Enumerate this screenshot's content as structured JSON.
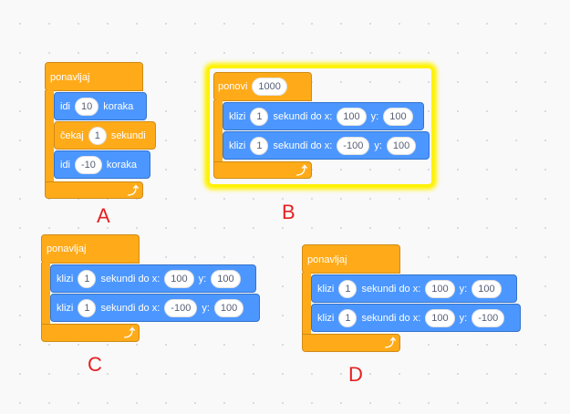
{
  "scripts": {
    "A": {
      "letter": "A",
      "loop_label": "ponavljaj",
      "blocks": [
        {
          "parts": [
            "idi",
            "10",
            "koraka"
          ]
        },
        {
          "parts": [
            "čekaj",
            "1",
            "sekundi"
          ]
        },
        {
          "parts": [
            "idi",
            "-10",
            "koraka"
          ]
        }
      ]
    },
    "B": {
      "letter": "B",
      "loop_label": "ponovi",
      "loop_count": "1000",
      "selected": true,
      "blocks": [
        {
          "parts": [
            "klizi",
            "1",
            "sekundi do x:",
            "100",
            "y:",
            "100"
          ]
        },
        {
          "parts": [
            "klizi",
            "1",
            "sekundi do x:",
            "-100",
            "y:",
            "100"
          ]
        }
      ]
    },
    "C": {
      "letter": "C",
      "loop_label": "ponavljaj",
      "blocks": [
        {
          "parts": [
            "klizi",
            "1",
            "sekundi do x:",
            "100",
            "y:",
            "100"
          ]
        },
        {
          "parts": [
            "klizi",
            "1",
            "sekundi do x:",
            "-100",
            "y:",
            "100"
          ]
        }
      ]
    },
    "D": {
      "letter": "D",
      "loop_label": "ponavljaj",
      "blocks": [
        {
          "parts": [
            "klizi",
            "1",
            "sekundi do x:",
            "100",
            "y:",
            "100"
          ]
        },
        {
          "parts": [
            "klizi",
            "1",
            "sekundi do x:",
            "100",
            "y:",
            "-100"
          ]
        }
      ]
    }
  },
  "icons": {
    "repeat_arrow": "loop-arrow-icon"
  },
  "colors": {
    "control": "#ffab19",
    "motion": "#4c97ff",
    "highlight": "#fff200",
    "letter": "#e62020"
  }
}
